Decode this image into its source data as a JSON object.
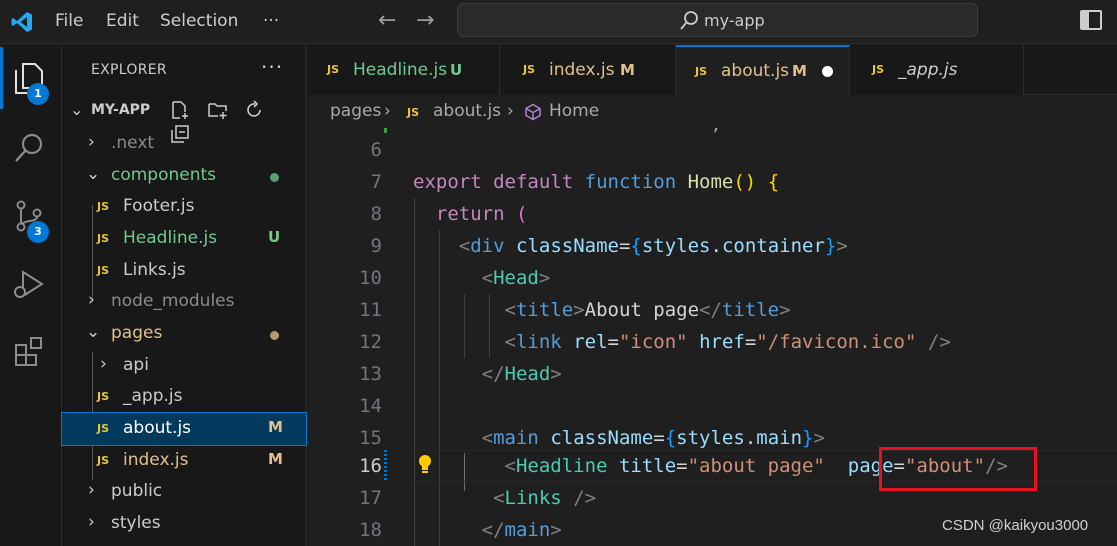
{
  "titlebar": {
    "menu": [
      "File",
      "Edit",
      "Selection",
      "···"
    ],
    "search_text": "my-app"
  },
  "activity": {
    "explorer_badge": "1",
    "scm_badge": "3"
  },
  "sidebar": {
    "title": "EXPLORER",
    "more": "···",
    "root": "MY-APP",
    "items": [
      {
        "label": ".next",
        "kind": "folder",
        "state": "collapsed"
      },
      {
        "label": "components",
        "kind": "folder",
        "state": "expanded"
      },
      {
        "label": "Footer.js",
        "kind": "js"
      },
      {
        "label": "Headline.js",
        "kind": "js",
        "decoration": "U"
      },
      {
        "label": "Links.js",
        "kind": "js"
      },
      {
        "label": "node_modules",
        "kind": "folder",
        "state": "collapsed"
      },
      {
        "label": "pages",
        "kind": "folder",
        "state": "expanded"
      },
      {
        "label": "api",
        "kind": "folder",
        "state": "collapsed"
      },
      {
        "label": "_app.js",
        "kind": "js"
      },
      {
        "label": "about.js",
        "kind": "js",
        "decoration": "M"
      },
      {
        "label": "index.js",
        "kind": "js",
        "decoration": "M"
      },
      {
        "label": "public",
        "kind": "folder",
        "state": "collapsed"
      },
      {
        "label": "styles",
        "kind": "folder",
        "state": "collapsed"
      }
    ]
  },
  "tabs": [
    {
      "label": "Headline.js",
      "flag": "U"
    },
    {
      "label": "index.js",
      "flag": "M"
    },
    {
      "label": "about.js",
      "flag": "M",
      "active": true,
      "dirty": true
    },
    {
      "label": "_app.js",
      "flag": ""
    }
  ],
  "breadcrumb": {
    "folder": "pages",
    "file": "about.js",
    "symbol": "Home"
  },
  "editor": {
    "line_numbers": [
      "6",
      "7",
      "8",
      "9",
      "10",
      "11",
      "12",
      "13",
      "14",
      "15",
      "16",
      "17",
      "18"
    ],
    "current_line": "16",
    "tokens": {
      "export": "export",
      "default": "default",
      "function": "function",
      "home": "Home",
      "return": "return",
      "div": "div",
      "classname": "className",
      "styles": "styles",
      "container": "container",
      "main_prop": "main",
      "head": "Head",
      "title_tag": "title",
      "title_text": "About page",
      "link": "link",
      "rel": "rel",
      "rel_val": "\"icon\"",
      "href": "href",
      "href_val": "\"/favicon.ico\"",
      "main": "main",
      "headline": "Headline",
      "title_attr": "title",
      "title_val": "\"about page\"",
      "page_attr": "page",
      "page_val": "\"about\"",
      "links": "Links"
    }
  },
  "watermark": "CSDN @kaikyou3000",
  "colors": {
    "accent": "#0078d4",
    "highlight_box": "#e81123"
  }
}
